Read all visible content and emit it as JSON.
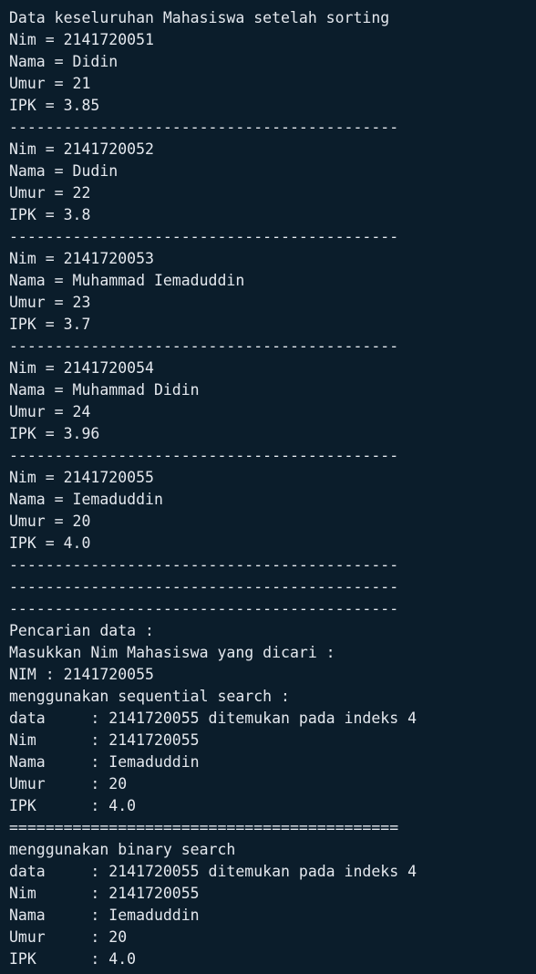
{
  "terminal": {
    "lines": [
      "Data keseluruhan Mahasiswa setelah sorting",
      "Nim = 2141720051",
      "Nama = Didin",
      "Umur = 21",
      "IPK = 3.85",
      "-------------------------------------------",
      "Nim = 2141720052",
      "Nama = Dudin",
      "Umur = 22",
      "IPK = 3.8",
      "-------------------------------------------",
      "Nim = 2141720053",
      "Nama = Muhammad Iemaduddin",
      "Umur = 23",
      "IPK = 3.7",
      "-------------------------------------------",
      "Nim = 2141720054",
      "Nama = Muhammad Didin",
      "Umur = 24",
      "IPK = 3.96",
      "-------------------------------------------",
      "Nim = 2141720055",
      "Nama = Iemaduddin",
      "Umur = 20",
      "IPK = 4.0",
      "-------------------------------------------",
      "-------------------------------------------",
      "-------------------------------------------",
      "Pencarian data :",
      "Masukkan Nim Mahasiswa yang dicari :",
      "NIM : 2141720055",
      "menggunakan sequential search :",
      "data     : 2141720055 ditemukan pada indeks 4",
      "Nim      : 2141720055",
      "Nama     : Iemaduddin",
      "Umur     : 20",
      "IPK      : 4.0",
      "===========================================",
      "menggunakan binary search",
      "data     : 2141720055 ditemukan pada indeks 4",
      "Nim      : 2141720055",
      "Nama     : Iemaduddin",
      "Umur     : 20",
      "IPK      : 4.0"
    ]
  }
}
